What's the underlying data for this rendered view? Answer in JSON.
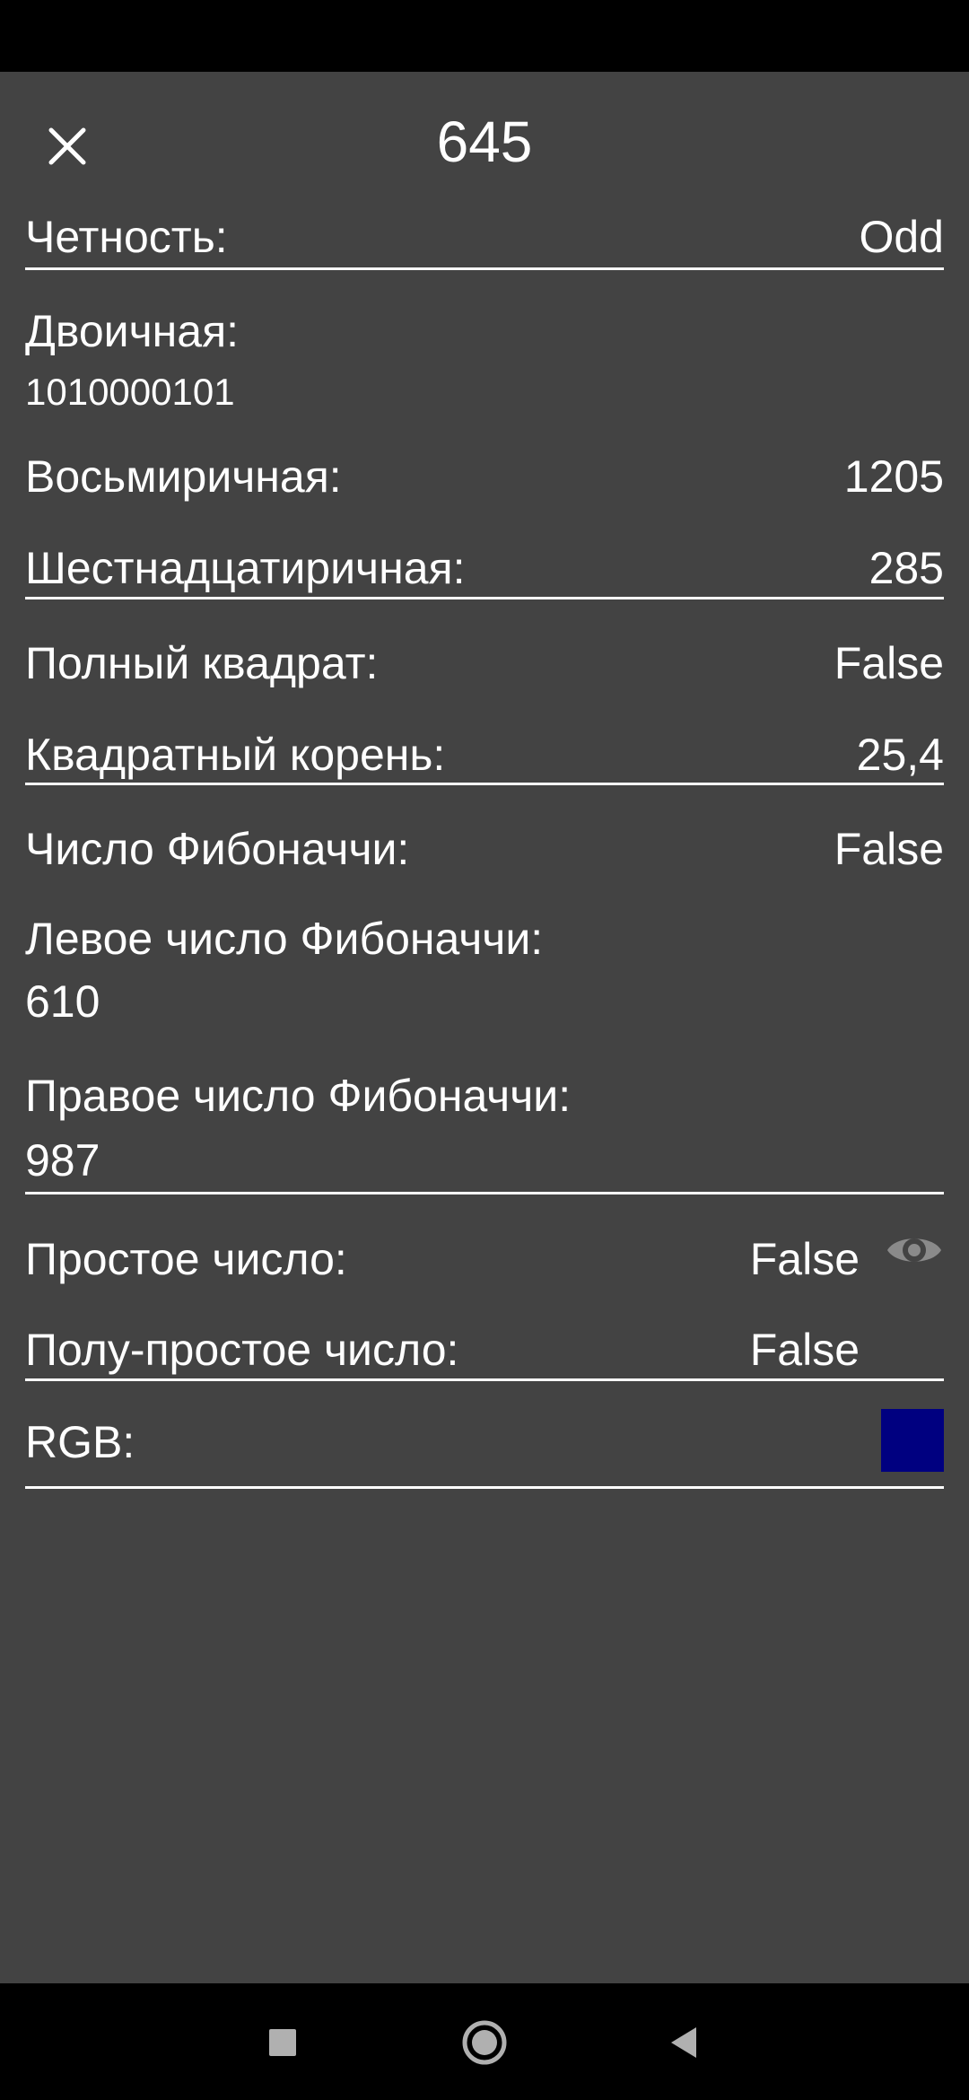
{
  "header": {
    "title": "645",
    "close_icon": "close-icon"
  },
  "rows": {
    "parity": {
      "label": "Четность:",
      "value": "Odd"
    },
    "binary": {
      "label": "Двоичная:",
      "value": "1010000101"
    },
    "octal": {
      "label": "Восьмиричная:",
      "value": "1205"
    },
    "hex": {
      "label": "Шестнадцатиричная:",
      "value": "285"
    },
    "perfect_square": {
      "label": "Полный квадрат:",
      "value": "False"
    },
    "square_root": {
      "label": "Квадратный корень:",
      "value": "25,4"
    },
    "fibonacci": {
      "label": "Число Фибоначчи:",
      "value": "False"
    },
    "left_fibonacci": {
      "label": "Левое число Фибоначчи:",
      "value": "610"
    },
    "right_fibonacci": {
      "label": "Правое число Фибоначчи:",
      "value": "987"
    },
    "prime": {
      "label": "Простое число:",
      "value": "False",
      "icon": "eye-icon"
    },
    "semiprime": {
      "label": "Полу-простое число:",
      "value": "False"
    },
    "rgb": {
      "label": "RGB:",
      "color": "#000080"
    }
  },
  "colors": {
    "background": "#434343",
    "text": "#ffffff",
    "divider": "#ffffff",
    "icon_muted": "#8a8a8a"
  },
  "nav": {
    "recents_icon": "square-icon",
    "home_icon": "circle-icon",
    "back_icon": "back-triangle-icon"
  }
}
